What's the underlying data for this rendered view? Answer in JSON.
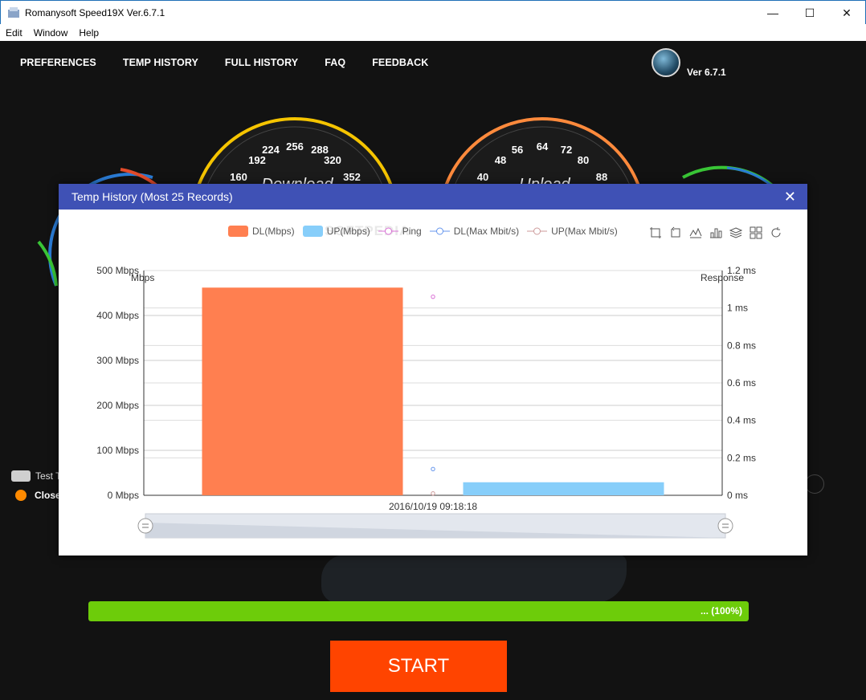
{
  "window": {
    "title": "Romanysoft Speed19X Ver.6.7.1",
    "minimize": "—",
    "maximize": "☐",
    "close": "✕"
  },
  "menu": [
    "Edit",
    "Window",
    "Help"
  ],
  "nav": [
    "PREFERENCES",
    "TEMP HISTORY",
    "FULL HISTORY",
    "FAQ",
    "FEEDBACK"
  ],
  "version": "Ver 6.7.1",
  "gauges": {
    "download": {
      "label": "Download",
      "ticks": [
        "160",
        "192",
        "224",
        "256",
        "288",
        "320",
        "352"
      ],
      "color": "#f5c400"
    },
    "upload": {
      "label": "Upload",
      "ticks": [
        "40",
        "48",
        "56",
        "64",
        "72",
        "80",
        "88"
      ],
      "color": "#ff8a3c"
    }
  },
  "side": {
    "test_label": "Test T",
    "close_label": "Close"
  },
  "progress": {
    "text": "... (100%)",
    "fraction": 1.0
  },
  "start_label": "START",
  "dialog": {
    "title": "Temp History (Most 25 Records)",
    "close": "✕",
    "legend": [
      {
        "name": "DL(Mbps)",
        "kind": "bar",
        "color": "#ff7f50"
      },
      {
        "name": "UP(Mbps)",
        "kind": "bar",
        "color": "#87cefa"
      },
      {
        "name": "Ping",
        "kind": "line",
        "color": "#da70d6"
      },
      {
        "name": "DL(Max Mbit/s)",
        "kind": "line",
        "color": "#6495ed"
      },
      {
        "name": "UP(Max Mbit/s)",
        "kind": "line",
        "color": "#cd9a9a"
      }
    ],
    "watermark": "SOFTPEDIA",
    "toolbox": [
      "zoom-icon",
      "zoom-reset-icon",
      "line-chart-icon",
      "bar-chart-icon",
      "stack-icon",
      "tiled-icon",
      "restore-icon"
    ]
  },
  "chart_data": {
    "type": "bar",
    "categories": [
      "2016/10/19 09:18:18"
    ],
    "ylabel_left": "Mbps",
    "ylabel_right": "Response",
    "ylim_left": [
      0,
      500
    ],
    "ylim_right": [
      0,
      1.2
    ],
    "yticks_left": [
      "0 Mbps",
      "100 Mbps",
      "200 Mbps",
      "300 Mbps",
      "400 Mbps",
      "500 Mbps"
    ],
    "yticks_right": [
      "0 ms",
      "0.2 ms",
      "0.4 ms",
      "0.6 ms",
      "0.8 ms",
      "1 ms",
      "1.2 ms"
    ],
    "series": [
      {
        "name": "DL(Mbps)",
        "axis": "left",
        "values": [
          462
        ],
        "color": "#ff7f50"
      },
      {
        "name": "UP(Mbps)",
        "axis": "left",
        "values": [
          29
        ],
        "color": "#87cefa"
      },
      {
        "name": "Ping",
        "axis": "right",
        "values": [
          1.06
        ],
        "color": "#da70d6"
      },
      {
        "name": "DL(Max Mbit/s)",
        "axis": "right",
        "values": [
          0.14
        ],
        "color": "#6495ed"
      },
      {
        "name": "UP(Max Mbit/s)",
        "axis": "right",
        "values": [
          0.01
        ],
        "color": "#cd9a9a"
      }
    ],
    "grid": true,
    "legend_position": "top-right"
  }
}
